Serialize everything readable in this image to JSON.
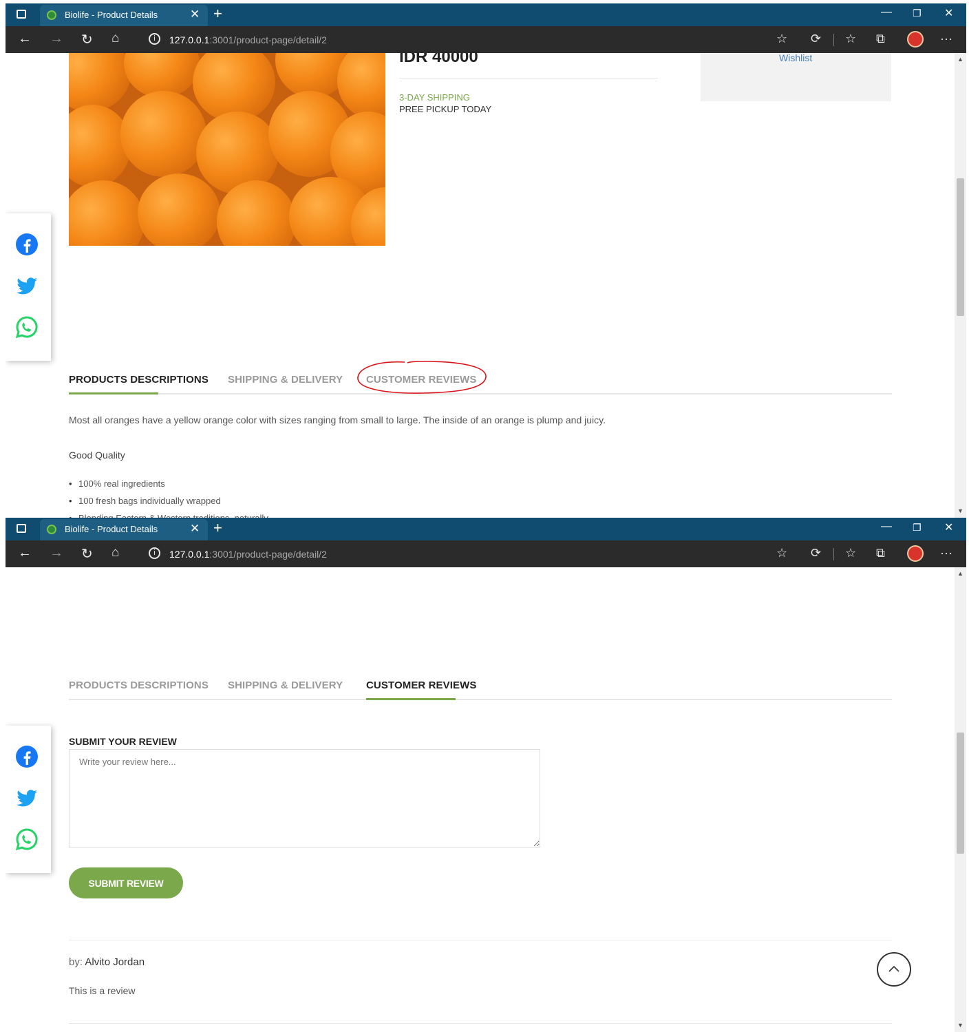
{
  "browser": {
    "tab_title": "Biolife - Product Details",
    "url_host": "127.0.0.1",
    "url_path": ":3001/product-page/detail/2"
  },
  "product": {
    "price": "IDR 40000",
    "shipping": "3-DAY SHIPPING",
    "pickup": "PREE PICKUP TODAY",
    "wishlist_label": "Wishlist"
  },
  "tabs": [
    {
      "label": "PRODUCTS DESCRIPTIONS"
    },
    {
      "label": "SHIPPING & DELIVERY"
    },
    {
      "label": "CUSTOMER REVIEWS"
    }
  ],
  "description": {
    "text": "Most all oranges have a yellow orange color with sizes ranging from small to large. The inside of an orange is plump and juicy.",
    "quality_heading": "Good Quality",
    "bullets": [
      "100% real ingredients",
      "100 fresh bags individually wrapped",
      "Blending Eastern & Western traditions, naturally"
    ]
  },
  "review_form": {
    "heading": "SUBMIT YOUR REVIEW",
    "placeholder": "Write your review here...",
    "submit_label": "SUBMIT REVIEW"
  },
  "reviews": [
    {
      "by_label": "by:",
      "author": "Alvito Jordan",
      "text": "This is a review"
    }
  ],
  "share_icons": [
    "facebook-icon",
    "twitter-icon",
    "whatsapp-icon"
  ],
  "colors": {
    "accent_green": "#7aa84b",
    "titlebar": "#0f4c6f",
    "annotation_red": "#d8141b"
  }
}
